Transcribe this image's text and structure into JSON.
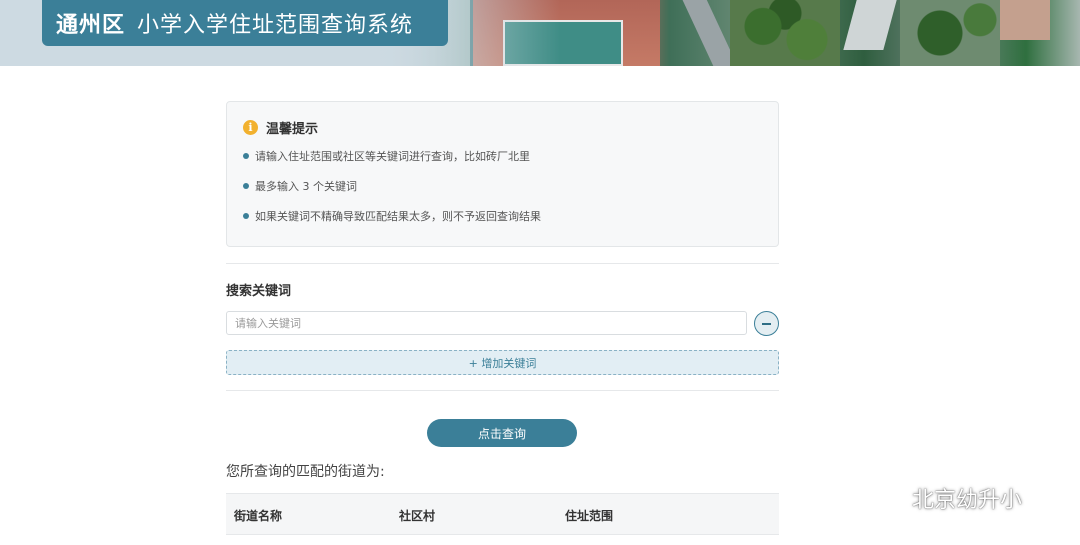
{
  "header": {
    "district": "通州区",
    "system_title": "小学入学住址范围查询系统"
  },
  "tips": {
    "title": "温馨提示",
    "items": [
      "请输入住址范围或社区等关键词进行查询，比如砖厂北里",
      "最多输入 3 个关键词",
      "如果关键词不精确导致匹配结果太多，则不予返回查询结果"
    ]
  },
  "search": {
    "label": "搜索关键词",
    "placeholder": "请输入关键词",
    "value": "",
    "add_label": "+ 增加关键词",
    "query_label": "点击查询"
  },
  "results": {
    "label": "您所查询的匹配的街道为:",
    "columns": [
      "街道名称",
      "社区村",
      "住址范围"
    ]
  },
  "watermark": {
    "text": "北京幼升小"
  },
  "colors": {
    "accent": "#3b7f98",
    "tip_icon": "#f2b12e"
  }
}
